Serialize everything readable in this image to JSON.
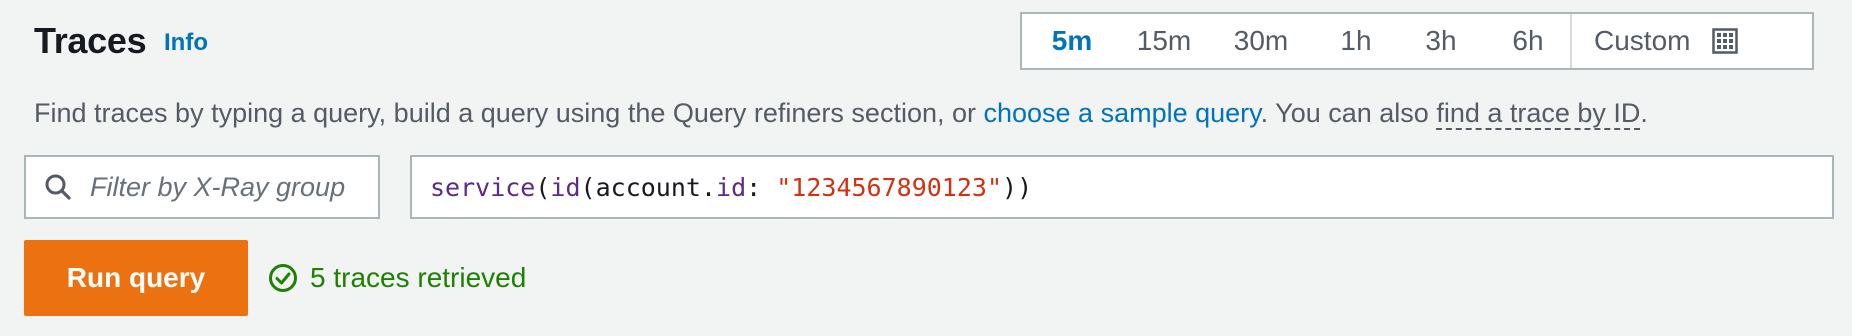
{
  "header": {
    "title": "Traces",
    "info_label": "Info"
  },
  "time_range": {
    "options": [
      {
        "label": "5m",
        "active": true
      },
      {
        "label": "15m",
        "active": false
      },
      {
        "label": "30m",
        "active": false
      },
      {
        "label": "1h",
        "active": false
      },
      {
        "label": "3h",
        "active": false
      },
      {
        "label": "6h",
        "active": false
      }
    ],
    "custom_label": "Custom",
    "custom_icon": "calendar-icon"
  },
  "description": {
    "prefix": "Find traces by typing a query, build a query using the Query refiners section, or ",
    "sample_link": "choose a sample query",
    "middle": ". You can also ",
    "find_link": "find a trace by ID",
    "suffix": "."
  },
  "group_filter": {
    "placeholder": "Filter by X-Ray group",
    "value": "",
    "icon": "search-icon"
  },
  "query": {
    "fn1": "service",
    "p1": "(",
    "fn2": "id",
    "p2": "(",
    "obj": "account.",
    "key": "id",
    "colon": ": ",
    "str": "\"1234567890123\"",
    "close": "))"
  },
  "actions": {
    "run_label": "Run query"
  },
  "status": {
    "text": "5 traces retrieved",
    "icon": "check-circle-icon",
    "color": "#1d8102"
  },
  "colors": {
    "accent": "#0073bb",
    "primary_button": "#ec7211",
    "string_token": "#d13212"
  }
}
